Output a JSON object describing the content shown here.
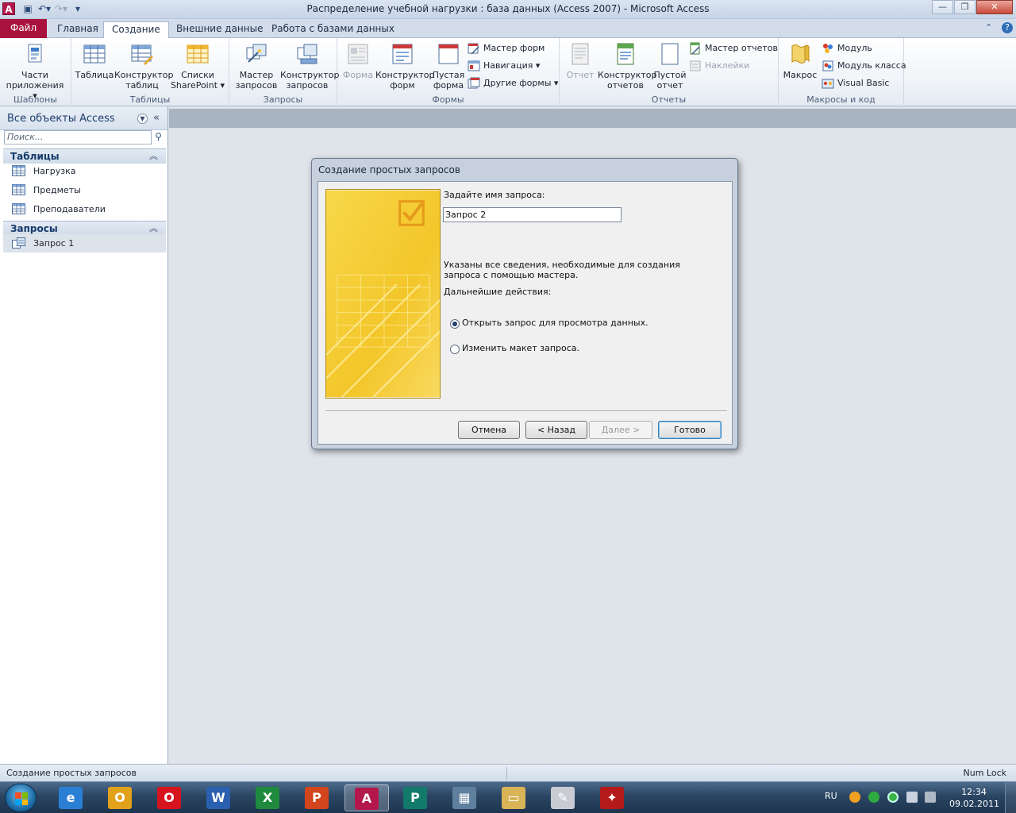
{
  "window": {
    "app_icon_letter": "A",
    "title": "Распределение учебной нагрузки : база данных (Access 2007)  -  Microsoft Access",
    "minimize": "—",
    "restore": "❐",
    "close": "✕"
  },
  "ribbon_tabs": [
    {
      "label": "Файл"
    },
    {
      "label": "Главная"
    },
    {
      "label": "Создание"
    },
    {
      "label": "Внешние данные"
    },
    {
      "label": "Работа с базами данных"
    }
  ],
  "ribbon_help": "⌃",
  "ribbon_help2": "?",
  "ribbon": {
    "templates": {
      "label": "Шаблоны",
      "app_parts": "Части приложения ▾"
    },
    "tables": {
      "label": "Таблицы",
      "table": "Таблица",
      "table_design": "Конструктор таблиц",
      "sharepoint_lists": "Списки SharePoint ▾"
    },
    "queries": {
      "label": "Запросы",
      "query_wizard": "Мастер запросов",
      "query_design": "Конструктор запросов"
    },
    "forms": {
      "label": "Формы",
      "form": "Форма",
      "form_design": "Конструктор форм",
      "blank_form": "Пустая форма",
      "form_wizard": "Мастер форм",
      "navigation": "Навигация ▾",
      "more_forms": "Другие формы ▾"
    },
    "reports": {
      "label": "Отчеты",
      "report": "Отчет",
      "report_design": "Конструктор отчетов",
      "blank_report": "Пустой отчет",
      "report_wizard": "Мастер отчетов",
      "labels": "Наклейки"
    },
    "macros": {
      "label": "Макросы и код",
      "macro": "Макрос",
      "module": "Модуль",
      "class_module": "Модуль класса",
      "visual_basic": "Visual Basic"
    }
  },
  "nav_pane": {
    "title": "Все объекты Access",
    "search_placeholder": "Поиск...",
    "sections": [
      {
        "label": "Таблицы",
        "items": [
          "Нагрузка",
          "Предметы",
          "Преподаватели"
        ]
      },
      {
        "label": "Запросы",
        "items": [
          "Запрос 1"
        ]
      }
    ]
  },
  "dialog": {
    "title": "Создание простых запросов",
    "prompt": "Задайте имя запроса:",
    "query_name": "Запрос 2",
    "info": "Указаны все сведения, необходимые для создания запроса с помощью мастера.",
    "next_actions": "Дальнейшие действия:",
    "options": [
      {
        "label": "Открыть запрос для просмотра данных.",
        "checked": true
      },
      {
        "label": "Изменить макет запроса.",
        "checked": false
      }
    ],
    "buttons": {
      "cancel": "Отмена",
      "back": "< Назад",
      "next": "Далее >",
      "finish": "Готово"
    }
  },
  "statusbar": {
    "left": "Создание простых запросов",
    "right": "Num Lock"
  },
  "taskbar": {
    "apps": [
      {
        "name": "internet-explorer-icon",
        "color": "#2a7fd4",
        "glyph": "e"
      },
      {
        "name": "outlook-icon",
        "color": "#e2a11a",
        "glyph": "O"
      },
      {
        "name": "opera-icon",
        "color": "#d6141d",
        "glyph": "O"
      },
      {
        "name": "word-icon",
        "color": "#2b5fb0",
        "glyph": "W"
      },
      {
        "name": "excel-icon",
        "color": "#1f8a3d",
        "glyph": "X"
      },
      {
        "name": "powerpoint-icon",
        "color": "#d2451d",
        "glyph": "P"
      },
      {
        "name": "access-icon",
        "color": "#b3174b",
        "glyph": "A"
      },
      {
        "name": "publisher-icon",
        "color": "#137a6b",
        "glyph": "P"
      },
      {
        "name": "calculator-icon",
        "color": "#5f7f9e",
        "glyph": "▦"
      },
      {
        "name": "explorer-icon",
        "color": "#d9b457",
        "glyph": "▭"
      },
      {
        "name": "scanner-icon",
        "color": "#c8ccd2",
        "glyph": "✎"
      },
      {
        "name": "pdf-icon",
        "color": "#b51a1a",
        "glyph": "✦"
      }
    ],
    "language": "RU",
    "time": "12:34",
    "date": "09.02.2011"
  }
}
